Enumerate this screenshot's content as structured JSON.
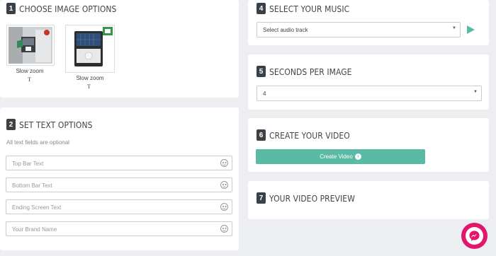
{
  "sections": {
    "choose_image": {
      "num": "1",
      "title": "CHOOSE IMAGE OPTIONS"
    },
    "text_options": {
      "num": "2",
      "title": "SET TEXT OPTIONS",
      "hint": "All text fields are optional"
    },
    "music": {
      "num": "4",
      "title": "SELECT YOUR MUSIC"
    },
    "seconds": {
      "num": "5",
      "title": "SECONDS PER IMAGE"
    },
    "create": {
      "num": "6",
      "title": "CREATE YOUR VIDEO"
    },
    "preview": {
      "num": "7",
      "title": "YOUR VIDEO PREVIEW"
    }
  },
  "images": [
    {
      "effect": "Slow zoom",
      "text_icon": "T"
    },
    {
      "effect": "Slow zoom",
      "text_icon": "T"
    }
  ],
  "text_fields": [
    {
      "placeholder": "Top Bar Text",
      "value": ""
    },
    {
      "placeholder": "Bottom Bar Text",
      "value": ""
    },
    {
      "placeholder": "Ending Screen Text",
      "value": ""
    },
    {
      "placeholder": "Your Brand Name",
      "value": ""
    }
  ],
  "music": {
    "selected": "Select audio track",
    "play_icon": "play-icon"
  },
  "seconds": {
    "selected": "4"
  },
  "create_button": {
    "label": "Create Video",
    "icon": "arrow-right-circle-icon"
  },
  "messenger": {
    "icon": "messenger-icon",
    "color": "#e3166e"
  },
  "colors": {
    "accent": "#5bbaa4",
    "badge": "#3b4148",
    "background": "#eceef1"
  }
}
